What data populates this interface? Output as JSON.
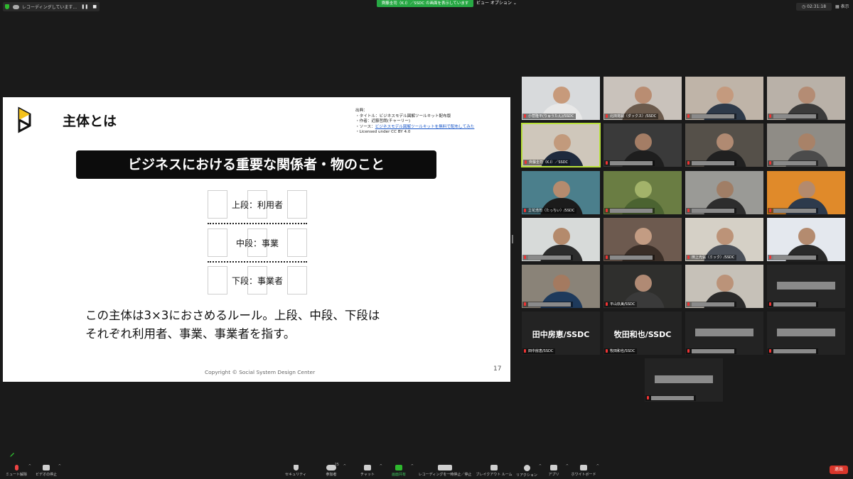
{
  "top": {
    "recording_status": "レコーディングしています...",
    "share_banner": "齊藤圭司（K.I）／SSDC の画面を表示しています",
    "view_options": "ビュー オプション",
    "timer": "02:31:18",
    "view_button": "表示"
  },
  "slide": {
    "title": "主体とは",
    "source_lines": [
      "出典：",
      "・タイトル：ビジネスモデル図解ツールキット配布版",
      "・作者：近藤哲朗(チャーリー)",
      "・ソース：",
      "・Licensed under CC BY 4.0"
    ],
    "source_link": "ビジネスモデル図解ツールキットを無料で配布してみた",
    "banner": "ビジネスにおける重要な関係者・物のこと",
    "rows": [
      "上段：利用者",
      "中段：事業",
      "下段：事業者"
    ],
    "body_lines": [
      "この主体は3×3におさめるルール。上段、中段、下段は",
      "それぞれ利用者、事業、事業者を指す。"
    ],
    "copyright": "Copyright © Social System Design Center",
    "page": "17"
  },
  "gallery": {
    "tiles": [
      {
        "name": "小菅隆平(りゅうたん)/SSDC",
        "bg": "#d8dadc",
        "skin": "#c79a7b",
        "cloth": "#e8e8e8"
      },
      {
        "name": "北田将嗣（ダックス）/SSDC",
        "bg": "#c9c2bb",
        "skin": "#b98d72",
        "cloth": "#6b5a4c"
      },
      {
        "name": "",
        "bg": "#bfb4a8",
        "skin": "#c49a7e",
        "cloth": "#2e3a4a"
      },
      {
        "name": "",
        "bg": "#b9b1a8",
        "skin": "#b48c74",
        "cloth": "#3b3b3b"
      },
      {
        "name": "齊藤圭司（K.I）／SSDC",
        "bg": "#cfc7bb",
        "skin": "#c29a7c",
        "cloth": "#1f2a3d",
        "active": true
      },
      {
        "name": "",
        "bg": "#3a3a3a",
        "skin": "#a47d65",
        "cloth": "#1e1e1e"
      },
      {
        "name": "",
        "bg": "#555049",
        "skin": "#b08a72",
        "cloth": "#202020"
      },
      {
        "name": "",
        "bg": "#8f8c86",
        "skin": "#a88268",
        "cloth": "#4b4b4b"
      },
      {
        "name": "立花浩司（たっちい）/SSDC",
        "bg": "#4b7f8c",
        "skin": "#b58b6e",
        "cloth": "#1b1b1b"
      },
      {
        "name": "",
        "bg": "#6a7d43",
        "skin": "#a3b36a",
        "cloth": "#4b6331"
      },
      {
        "name": "",
        "bg": "#9a9a96",
        "skin": "#a07e66",
        "cloth": "#2d2d2d"
      },
      {
        "name": "",
        "bg": "#e08a2a",
        "skin": "#b48a6d",
        "cloth": "#2d3a4c"
      },
      {
        "name": "",
        "bg": "#d7dad9",
        "skin": "#b48a6c",
        "cloth": "#2c2c2c"
      },
      {
        "name": "",
        "bg": "#6d5a4f",
        "skin": "#c39c83",
        "cloth": "#3a2e27"
      },
      {
        "name": "田上光弘（ミック）/SSDC",
        "bg": "#d5d0c6",
        "skin": "#bc9378",
        "cloth": "#4a4f58"
      },
      {
        "name": "",
        "bg": "#e4e8ee",
        "skin": "#b48b6f",
        "cloth": "#2a2a2a"
      },
      {
        "name": "",
        "bg": "#8a8378",
        "skin": "#a47a60",
        "cloth": "#1e3a5c"
      },
      {
        "name": "平山玖美/SSDC",
        "bg": "#2f2f2d",
        "skin": "#b08a74",
        "cloth": "#3a3a3a"
      },
      {
        "name": "",
        "bg": "#c6c1b8",
        "skin": "#bb9379",
        "cloth": "#2a2a2a"
      },
      {
        "name": "",
        "bg": "#262626",
        "skin": "",
        "cloth": "",
        "blank": true
      },
      {
        "name": "田中房恵/SSDC",
        "bg": "#232323",
        "big": "田中房恵/SSDC"
      },
      {
        "name": "牧田和也/SSDC",
        "bg": "#232323",
        "big": "牧田和也/SSDC"
      },
      {
        "name": "",
        "bg": "#232323",
        "blank": true
      },
      {
        "name": "",
        "bg": "#232323",
        "blank": true
      },
      {
        "name": "",
        "bg": "#232323",
        "blank": true
      }
    ]
  },
  "toolbar": {
    "mute": "ミュート解除",
    "video": "ビデオの停止",
    "security": "セキュリティ",
    "participants": "参加者",
    "participant_count": "25",
    "chat": "チャット",
    "share": "画面共有",
    "record": "レコーディングを一時停止／停止",
    "breakout": "ブレイクアウト ルーム",
    "reactions": "リアクション",
    "apps": "アプリ",
    "whiteboard": "ホワイトボード",
    "end": "退出"
  }
}
